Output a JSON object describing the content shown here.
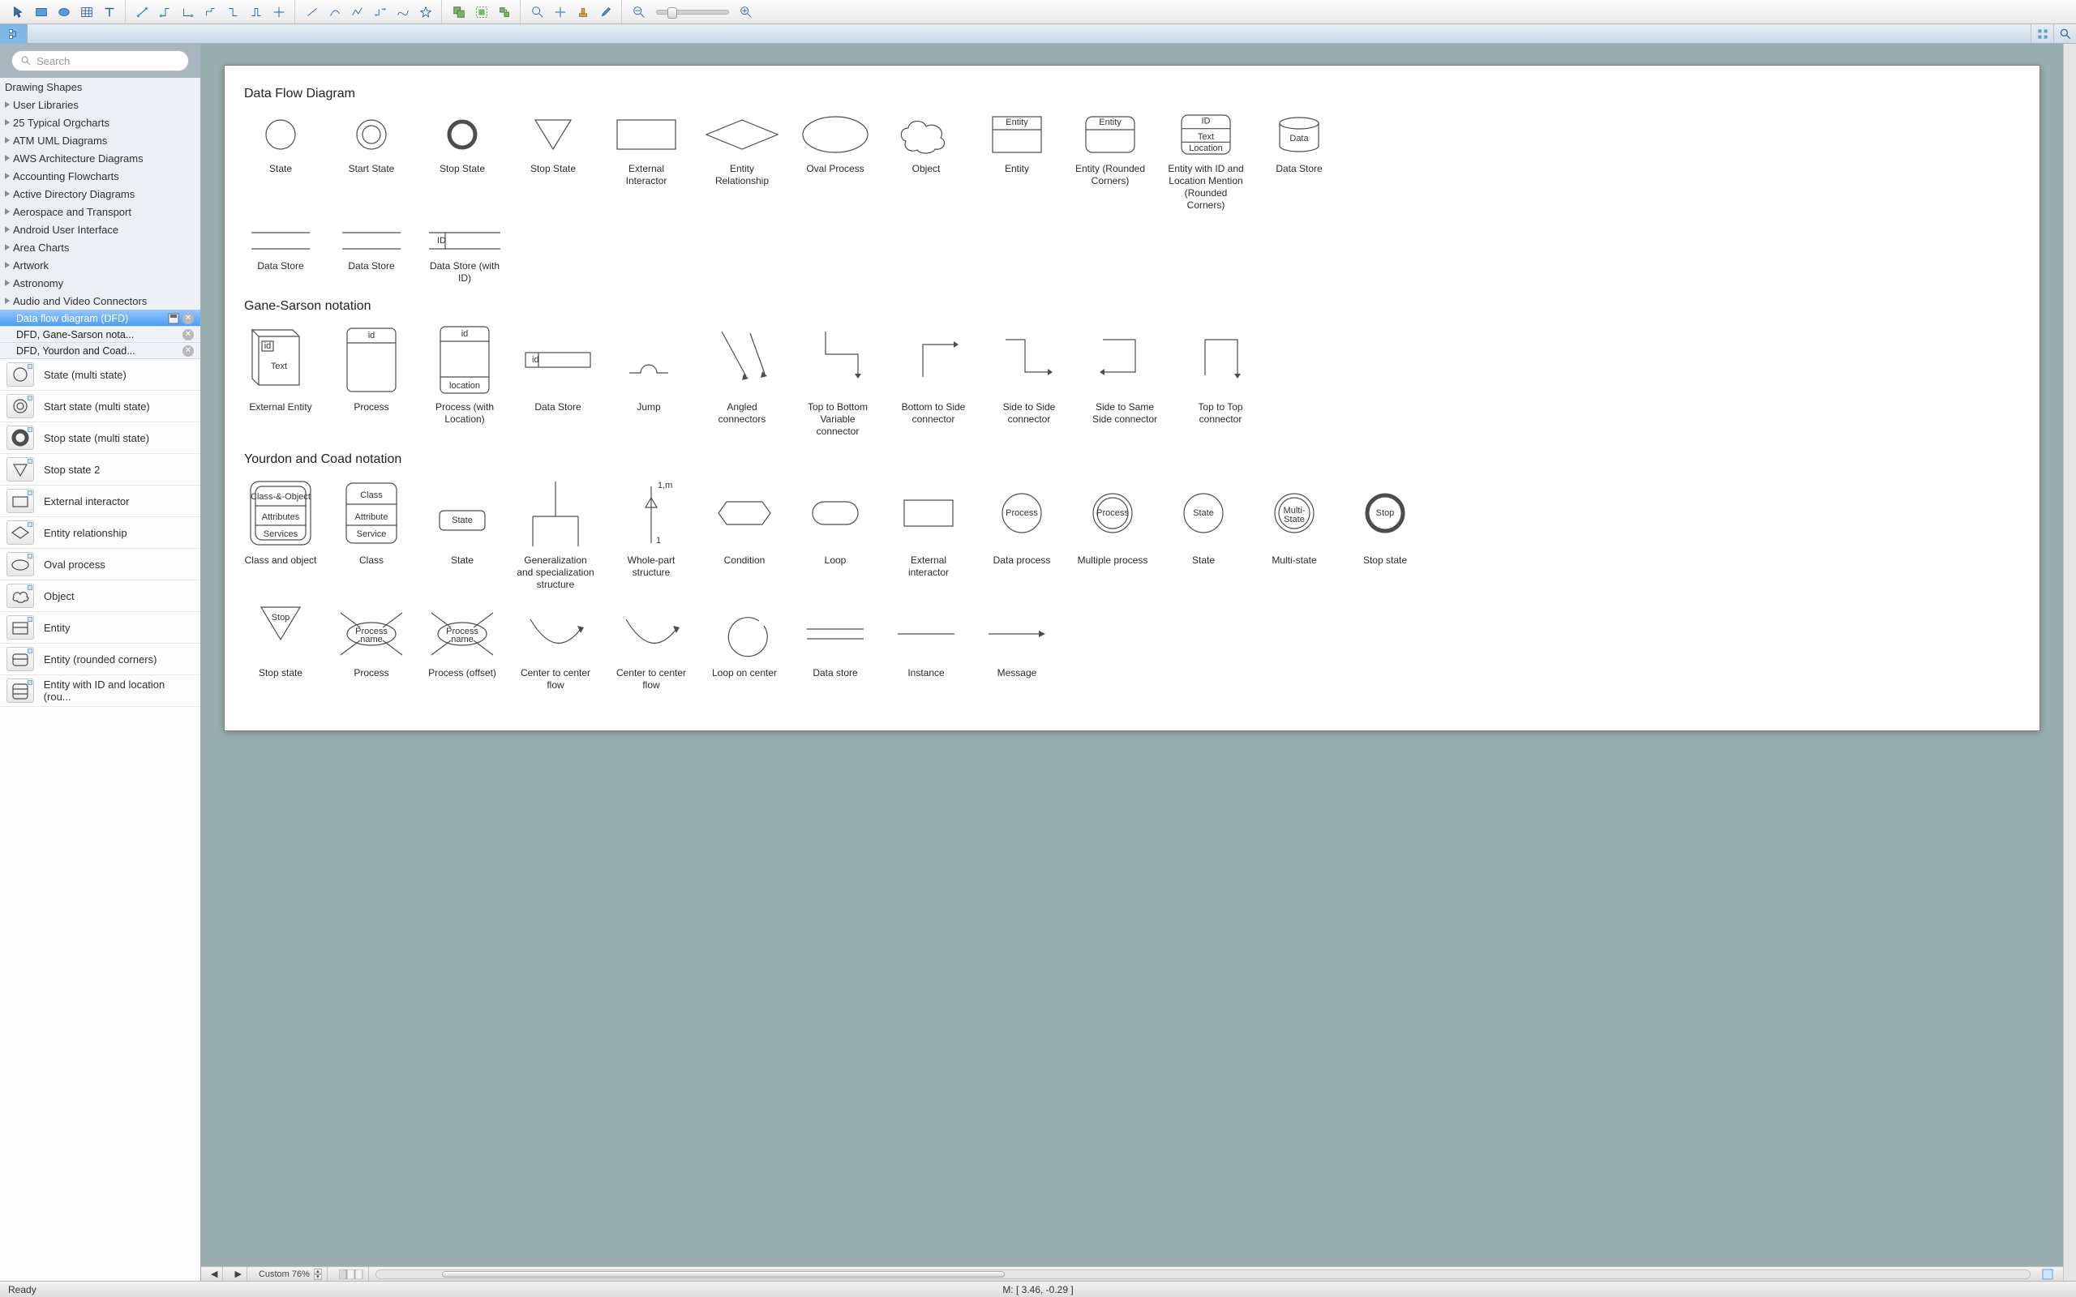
{
  "toolbar": {
    "groups": [
      [
        "pointer",
        "select-rect",
        "ellipse-tool",
        "table-tool",
        "text-tool"
      ],
      [
        "connector-ortho",
        "connector-l",
        "connector-s",
        "connector-z",
        "connector-t",
        "connector-u",
        "connector-star"
      ],
      [
        "line",
        "arc",
        "polyline",
        "bezier",
        "spline",
        "free"
      ],
      [
        "group-a",
        "group-b",
        "group-c"
      ],
      [
        "zoom-in",
        "pan",
        "stamp",
        "eyedropper"
      ]
    ],
    "zoom": {
      "minus": "zoom-out",
      "plus": "zoom-in-2"
    }
  },
  "panelbar": {
    "tree": "tree-icon",
    "grid": "grid-icon",
    "search": "search-icon"
  },
  "search_placeholder": "Search",
  "libraries": [
    "Drawing Shapes",
    "User Libraries",
    "25 Typical Orgcharts",
    "ATM UML Diagrams",
    "AWS Architecture Diagrams",
    "Accounting Flowcharts",
    "Active Directory Diagrams",
    "Aerospace and Transport",
    "Android User Interface",
    "Area Charts",
    "Artwork",
    "Astronomy",
    "Audio and Video Connectors"
  ],
  "tabs": [
    {
      "label": "Data flow diagram (DFD)",
      "selected": true,
      "save": true,
      "close": true
    },
    {
      "label": "DFD, Gane-Sarson nota...",
      "selected": false,
      "save": false,
      "close": true
    },
    {
      "label": "DFD, Yourdon and Coad...",
      "selected": false,
      "save": false,
      "close": true
    }
  ],
  "shapes_panel": [
    "State (multi state)",
    "Start state (multi state)",
    "Stop state (multi state)",
    "Stop state 2",
    "External interactor",
    "Entity relationship",
    "Oval process",
    "Object",
    "Entity",
    "Entity (rounded corners)",
    "Entity with ID and location (rou..."
  ],
  "sections": [
    {
      "title": "Data Flow Diagram",
      "items": [
        {
          "k": "circle",
          "lbl": "State"
        },
        {
          "k": "dbl",
          "lbl": "Start State"
        },
        {
          "k": "thick",
          "lbl": "Stop State"
        },
        {
          "k": "tri",
          "lbl": "Stop State"
        },
        {
          "k": "rect",
          "lbl": "External Interactor"
        },
        {
          "k": "diamond",
          "lbl": "Entity Relationship"
        },
        {
          "k": "oval",
          "lbl": "Oval Process"
        },
        {
          "k": "cloud",
          "lbl": "Object"
        },
        {
          "k": "ent",
          "lbl": "Entity",
          "txt": "Entity"
        },
        {
          "k": "entr",
          "lbl": "Entity (Rounded Corners)",
          "txt": "Entity"
        },
        {
          "k": "ent3",
          "lbl": "Entity with ID and Location Mention (Rounded Corners)",
          "rows": [
            "ID",
            "Text",
            "Location"
          ]
        },
        {
          "k": "cyl",
          "lbl": "Data Store",
          "txt": "Data"
        }
      ],
      "row2": [
        {
          "k": "ds",
          "lbl": "Data Store"
        },
        {
          "k": "ds",
          "lbl": "Data Store"
        },
        {
          "k": "dsid",
          "lbl": "Data Store (with ID)",
          "txt": "ID"
        }
      ]
    },
    {
      "title": "Gane-Sarson notation",
      "items": [
        {
          "k": "ext3d",
          "lbl": "External Entity",
          "rows": [
            "id",
            "Text"
          ]
        },
        {
          "k": "proc",
          "lbl": "Process",
          "rows": [
            "id"
          ]
        },
        {
          "k": "procL",
          "lbl": "Process (with Location)",
          "rows": [
            "id",
            "",
            "location"
          ]
        },
        {
          "k": "dsid2",
          "lbl": "Data Store",
          "txt": "id"
        },
        {
          "k": "jump",
          "lbl": "Jump"
        },
        {
          "k": "ang",
          "lbl": "Angled connectors"
        },
        {
          "k": "tbv",
          "lbl": "Top to Bottom Variable connector"
        },
        {
          "k": "bts",
          "lbl": "Bottom to Side connector"
        },
        {
          "k": "sts",
          "lbl": "Side to Side connector"
        },
        {
          "k": "ssame",
          "lbl": "Side to Same Side connector"
        },
        {
          "k": "ttop",
          "lbl": "Top to Top connector"
        }
      ]
    },
    {
      "title": "Yourdon and Coad notation",
      "items": [
        {
          "k": "cao",
          "lbl": "Class and object",
          "rows": [
            "Class-&-Object",
            "Attributes",
            "Services"
          ]
        },
        {
          "k": "cls",
          "lbl": "Class",
          "rows": [
            "Class",
            "Attribute",
            "Service"
          ]
        },
        {
          "k": "stbox",
          "lbl": "State",
          "txt": "State"
        },
        {
          "k": "gen",
          "lbl": "Generalization and specialization structure"
        },
        {
          "k": "whole",
          "lbl": "Whole-part structure",
          "rows": [
            "1,m",
            "1"
          ]
        },
        {
          "k": "hex",
          "lbl": "Condition"
        },
        {
          "k": "loop",
          "lbl": "Loop"
        },
        {
          "k": "rect2",
          "lbl": "External interactor"
        },
        {
          "k": "dproc",
          "lbl": "Data process",
          "txt": "Process"
        },
        {
          "k": "mproc",
          "lbl": "Multiple process",
          "txt": "Process"
        },
        {
          "k": "stc",
          "lbl": "State",
          "txt": "State"
        },
        {
          "k": "msc",
          "lbl": "Multi-state",
          "txt": "Multi-State"
        },
        {
          "k": "stopc",
          "lbl": "Stop state",
          "txt": "Stop"
        }
      ],
      "row2": [
        {
          "k": "tri2",
          "lbl": "Stop state",
          "txt": "Stop"
        },
        {
          "k": "pflow",
          "lbl": "Process",
          "txt": "Process name"
        },
        {
          "k": "pflow",
          "lbl": "Process (offset)",
          "txt": "Process name"
        },
        {
          "k": "arcf",
          "lbl": "Center to center flow"
        },
        {
          "k": "arcf",
          "lbl": "Center to center flow"
        },
        {
          "k": "loopc",
          "lbl": "Loop on center"
        },
        {
          "k": "dline",
          "lbl": "Data store"
        },
        {
          "k": "inst",
          "lbl": "Instance"
        },
        {
          "k": "msg",
          "lbl": "Message"
        }
      ]
    }
  ],
  "bottombar": {
    "zoom_label": "Custom 76%"
  },
  "status": {
    "ready": "Ready",
    "mouse": "M: [ 3.46, -0.29 ]"
  }
}
